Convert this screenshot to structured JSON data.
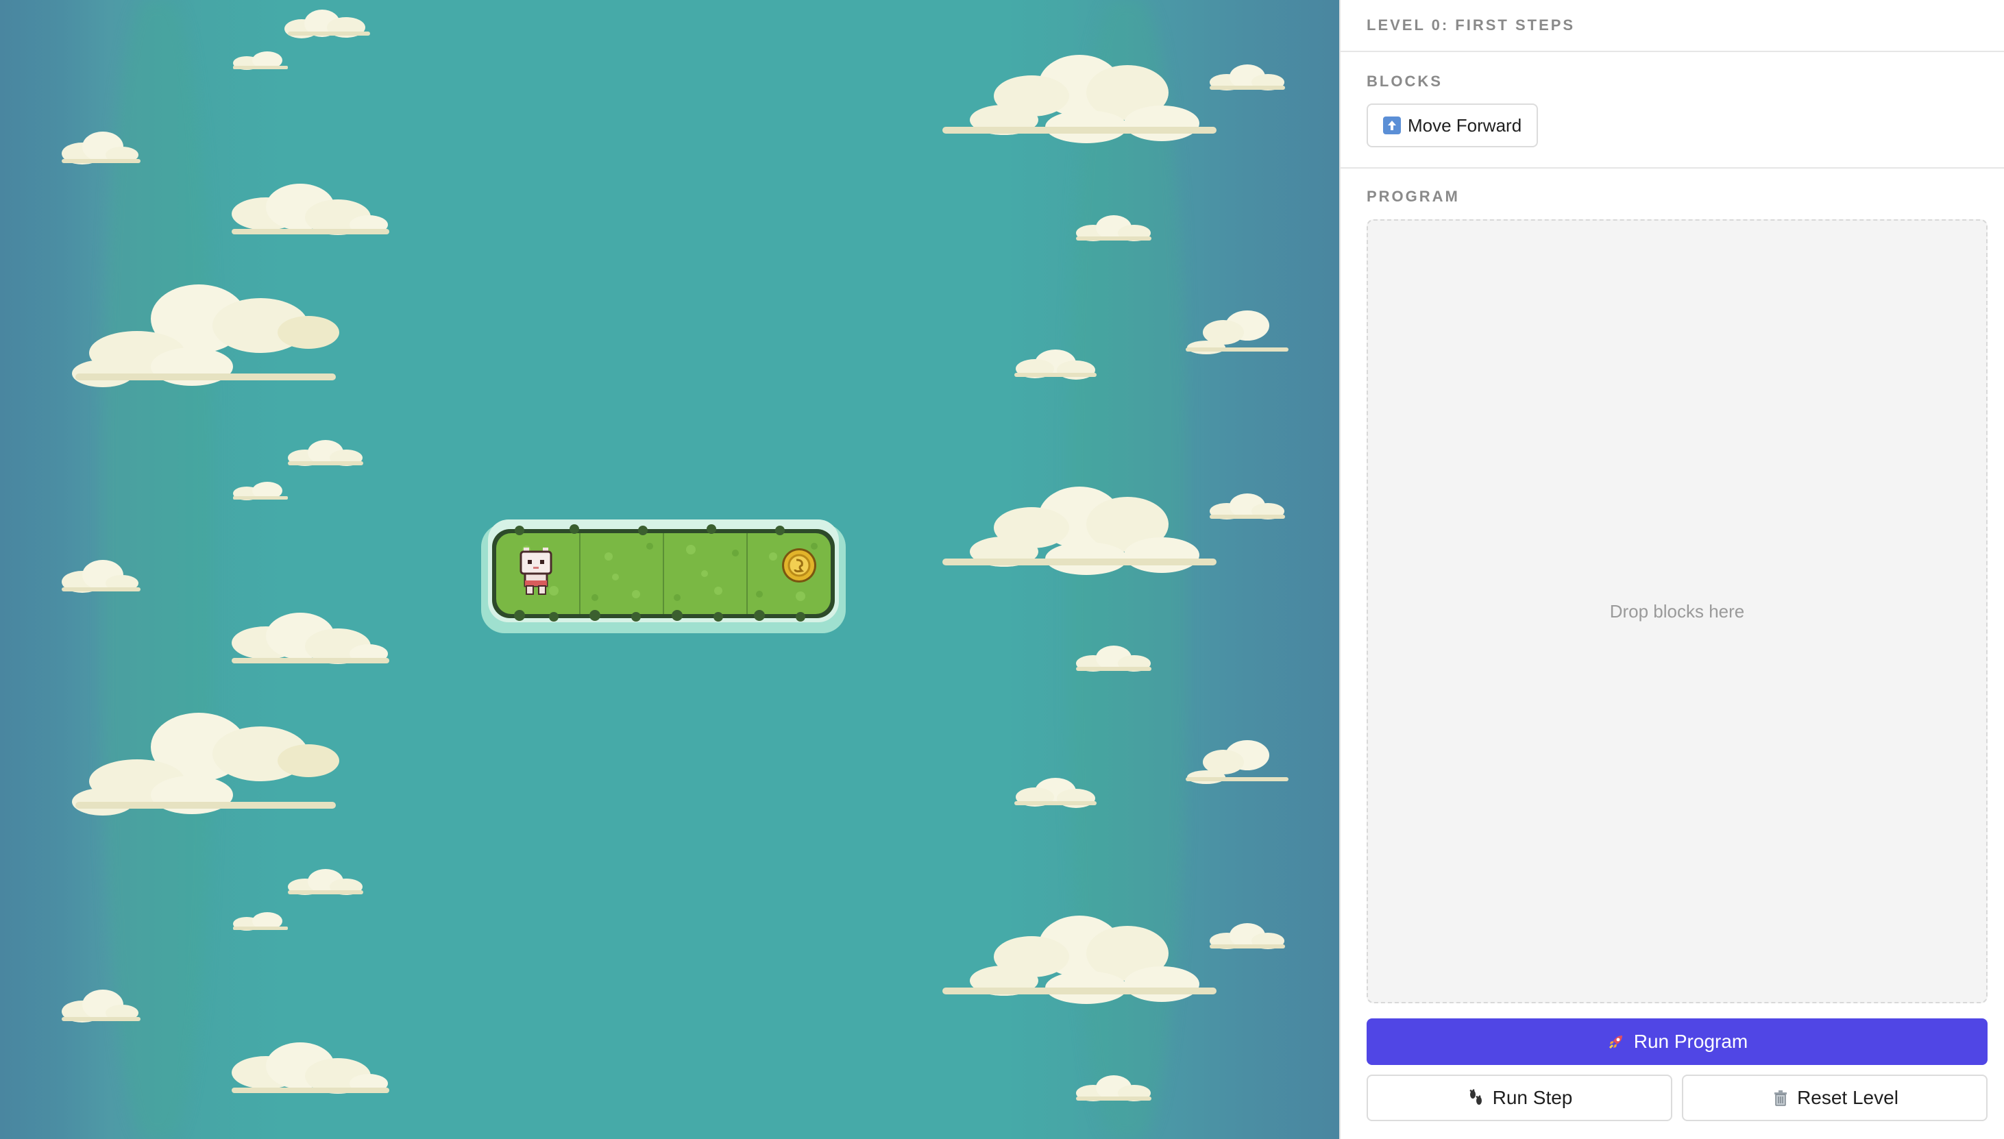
{
  "level": {
    "title": "LEVEL 0: FIRST STEPS"
  },
  "blocks": {
    "label": "BLOCKS",
    "items": [
      {
        "label": "Move Forward",
        "icon": "arrow-up-icon"
      }
    ]
  },
  "program": {
    "label": "PROGRAM",
    "placeholder": "Drop blocks here"
  },
  "controls": {
    "run_program": "Run Program",
    "run_program_icon": "rocket-icon",
    "run_step": "Run Step",
    "run_step_icon": "footprints-icon",
    "reset_level": "Reset Level",
    "reset_level_icon": "trash-icon"
  },
  "game": {
    "island_tiles": 4,
    "player_tile": 1,
    "coin_tile": 4
  },
  "colors": {
    "accent": "#5046e5",
    "water": "#46aaa8",
    "grass": "#7ab844",
    "coin": "#e2b42a"
  }
}
